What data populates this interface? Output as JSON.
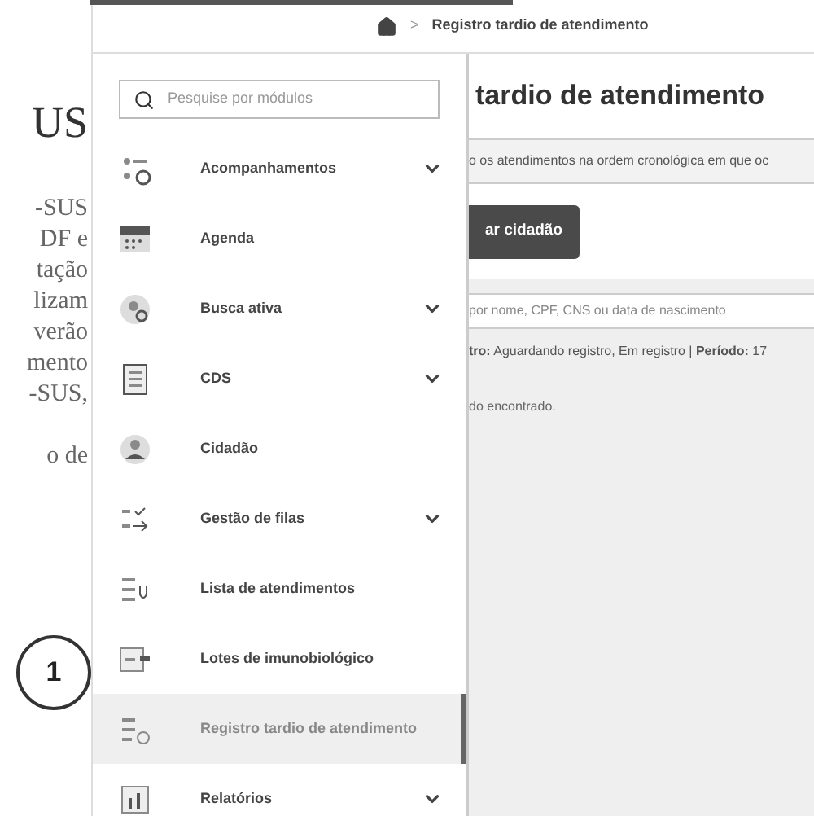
{
  "document": {
    "heading": "US",
    "paragraph_lines": [
      "-SUS",
      "DF e",
      "tação",
      "lizam",
      "verão",
      "mento",
      "-SUS,"
    ],
    "next_paragraph_line": "o de",
    "callout": "1"
  },
  "breadcrumb": {
    "separator": ">",
    "current": "Registro tardio de atendimento"
  },
  "menu": {
    "search": {
      "placeholder": "Pesquise por módulos"
    },
    "items": [
      {
        "label": "Acompanhamentos",
        "expandable": true,
        "selected": false
      },
      {
        "label": "Agenda",
        "expandable": false,
        "selected": false
      },
      {
        "label": "Busca ativa",
        "expandable": true,
        "selected": false
      },
      {
        "label": "CDS",
        "expandable": true,
        "selected": false
      },
      {
        "label": "Cidadão",
        "expandable": false,
        "selected": false
      },
      {
        "label": "Gestão de filas",
        "expandable": true,
        "selected": false
      },
      {
        "label": "Lista de atendimentos",
        "expandable": false,
        "selected": false
      },
      {
        "label": "Lotes de imunobiológico",
        "expandable": false,
        "selected": false
      },
      {
        "label": "Registro tardio de atendimento",
        "expandable": false,
        "selected": true
      },
      {
        "label": "Relatórios",
        "expandable": true,
        "selected": false
      }
    ]
  },
  "page": {
    "title": "tardio de atendimento",
    "info": "o os atendimentos na ordem cronológica em que oc",
    "button": "ar cidadão",
    "search": {
      "placeholder": "por nome, CPF, CNS ou data de nascimento"
    },
    "filter": "**tro:** Aguardando registro, Em registro | **Período:** 17",
    "empty": "do encontrado."
  }
}
